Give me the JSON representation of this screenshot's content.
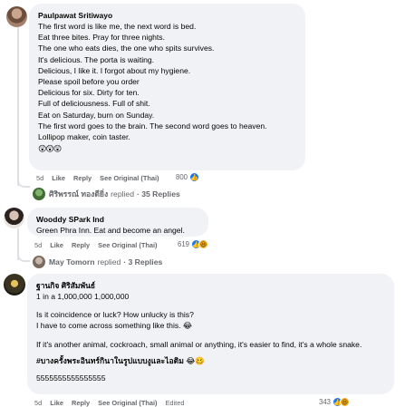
{
  "comments": [
    {
      "author": "Paulpawat Sritiwayo",
      "lines": [
        "The first word is like me, the next word is bed.",
        "Eat three bites. Pray for three nights.",
        "The one who eats dies, the one who spits survives.",
        "It's delicious. The porta is waiting.",
        "Delicious, I like it. I forgot about my hygiene.",
        "Please spoil before you order",
        "Delicious for six. Dirty for ten.",
        "Full of deliciousness. Full of shit.",
        "Eat on Saturday, burn on Sunday.",
        "The first word goes to the brain. The second word goes to heaven.",
        "Lollipop maker, coin taster."
      ],
      "emoji_line": "😲😲😲",
      "time": "5d",
      "like_label": "Like",
      "reply_label": "Reply",
      "see_original_label": "See Original (Thai)",
      "reaction_count": "800",
      "replies": {
        "name": "ศิริพรรณ์ ทองดียิ่ง",
        "replied_label": "replied",
        "count_label": "· 35 Replies"
      }
    },
    {
      "author": "Wooddy SPark Ind",
      "lines": [
        "Green Phra Inn. Eat and become an angel."
      ],
      "time": "5d",
      "like_label": "Like",
      "reply_label": "Reply",
      "see_original_label": "See Original (Thai)",
      "reaction_count": "619",
      "replies": {
        "name": "May Tomorn",
        "replied_label": "replied",
        "count_label": "· 3 Replies"
      }
    },
    {
      "author": "ฐานกิจ ศิริสัมพันธ์",
      "line1": "1 in a 1,000,000 1,000,000",
      "para2_line1": "Is it coincidence or luck? How unlucky is this?",
      "para2_line2": "I have to come across something like this. 😂",
      "para3": "If it's another animal, cockroach, small animal or anything, it's easier to find, it's a whole snake.",
      "hashtag": "#บางครั้งพระอินทร์กินาในรูปแบบงูและไอติม 😂🥴",
      "fives": "5555555555555555",
      "time": "5d",
      "like_label": "Like",
      "reply_label": "Reply",
      "see_original_label": "See Original (Thai)",
      "edited_label": "Edited",
      "reaction_count": "343"
    }
  ],
  "colors": {
    "bubble": "#f0f2f5",
    "meta_text": "#65676b",
    "like_blue": "#1877f2",
    "haha_yellow": "#f7b125"
  }
}
